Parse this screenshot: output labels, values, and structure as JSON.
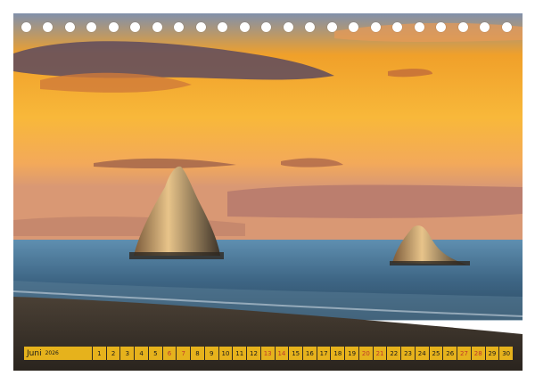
{
  "calendar": {
    "month": "Juni",
    "year": "2026",
    "days": [
      "1",
      "2",
      "3",
      "4",
      "5",
      "6",
      "7",
      "8",
      "9",
      "10",
      "11",
      "12",
      "13",
      "14",
      "15",
      "16",
      "17",
      "18",
      "19",
      "20",
      "21",
      "22",
      "23",
      "24",
      "25",
      "26",
      "27",
      "28",
      "29",
      "30"
    ],
    "weekend_days": [
      "6",
      "7",
      "13",
      "14",
      "20",
      "21",
      "27",
      "28"
    ]
  },
  "colors": {
    "strip": "#e6b21c",
    "weekend_text": "#c0392b",
    "sky_top": "#7a8aa8",
    "sky_glow": "#f7b231",
    "sea": "#3d5f7d",
    "sand": "#3a3128"
  }
}
